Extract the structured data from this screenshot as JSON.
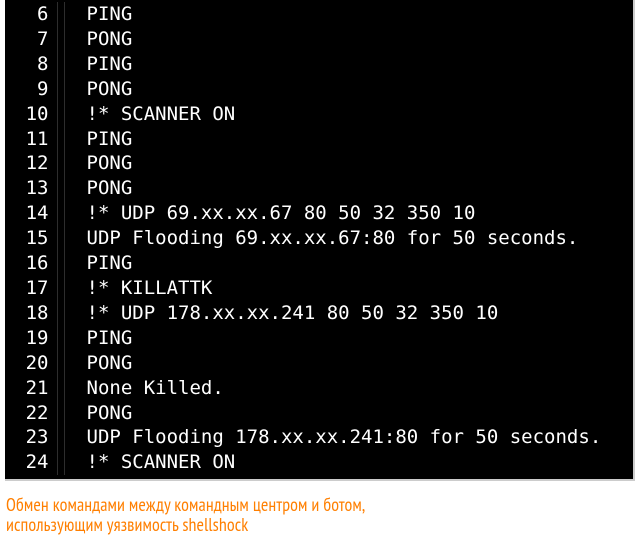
{
  "terminal": {
    "lines": [
      {
        "num": "6",
        "text": "PING"
      },
      {
        "num": "7",
        "text": "PONG"
      },
      {
        "num": "8",
        "text": "PING"
      },
      {
        "num": "9",
        "text": "PONG"
      },
      {
        "num": "10",
        "text": "!* SCANNER ON"
      },
      {
        "num": "11",
        "text": "PING"
      },
      {
        "num": "12",
        "text": "PONG"
      },
      {
        "num": "13",
        "text": "PONG"
      },
      {
        "num": "14",
        "text": "!* UDP 69.xx.xx.67 80 50 32 350 10"
      },
      {
        "num": "15",
        "text": "UDP Flooding 69.xx.xx.67:80 for 50 seconds."
      },
      {
        "num": "16",
        "text": "PING"
      },
      {
        "num": "17",
        "text": "!* KILLATTK"
      },
      {
        "num": "18",
        "text": "!* UDP 178.xx.xx.241 80 50 32 350 10"
      },
      {
        "num": "19",
        "text": "PING"
      },
      {
        "num": "20",
        "text": "PONG"
      },
      {
        "num": "21",
        "text": "None Killed."
      },
      {
        "num": "22",
        "text": "PONG"
      },
      {
        "num": "23",
        "text": "UDP Flooding 178.xx.xx.241:80 for 50 seconds."
      },
      {
        "num": "24",
        "text": "!* SCANNER ON"
      }
    ]
  },
  "caption": {
    "line1": "Обмен командами между командным центром и ботом,",
    "line2": "использующим уязвимость shellshock"
  }
}
